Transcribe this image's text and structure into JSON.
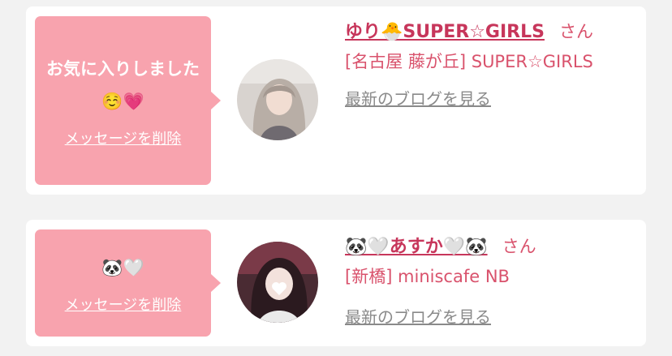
{
  "favorites": [
    {
      "bubble_text": "お気に入りしました☺️💗",
      "delete_label": "メッセージを削除",
      "name": "ゆり🐣SUPER☆GIRLS",
      "honorific": "さん",
      "shop": "[名古屋 藤が丘] SUPER☆GIRLS",
      "blog_link": "最新のブログを見る",
      "avatar_icon": "user-photo-avatar"
    },
    {
      "bubble_text": "🐼🤍",
      "delete_label": "メッセージを削除",
      "name": "🐼🤍あすか🤍🐼",
      "honorific": "さん",
      "shop": "[新橋] miniscafe NB",
      "blog_link": "最新のブログを見る",
      "avatar_icon": "user-photo-avatar"
    }
  ],
  "colors": {
    "background": "#f2f2f2",
    "card": "#ffffff",
    "bubble": "#f8a3ae",
    "name": "#c7365b",
    "shop": "#d9526c",
    "link_gray": "#8a8a8a"
  }
}
